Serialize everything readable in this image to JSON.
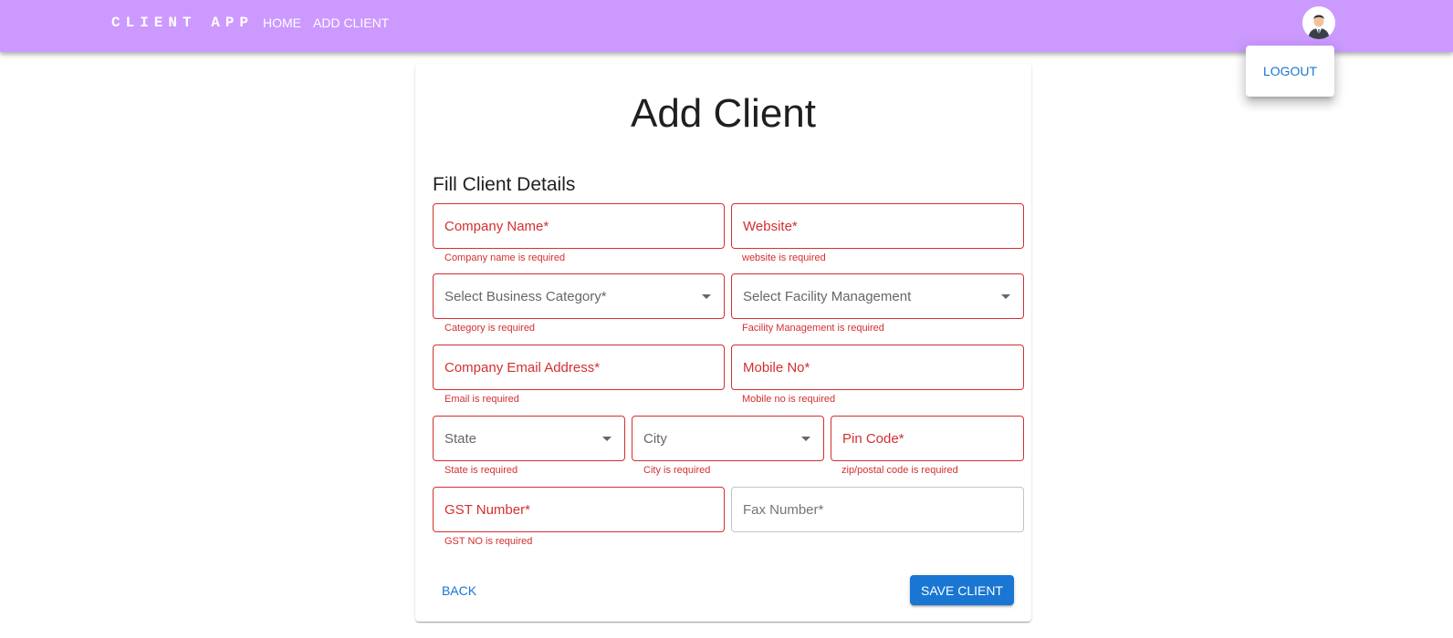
{
  "header": {
    "brand": "CLIENT APP",
    "nav": {
      "home": "HOME",
      "add_client": "ADD CLIENT"
    },
    "avatar_icon": "user-avatar-icon"
  },
  "user_menu": {
    "logout": "LOGOUT"
  },
  "form": {
    "title": "Add Client",
    "subtitle": "Fill Client Details",
    "fields": {
      "company_name": {
        "label": "Company Name*",
        "error": "Company name is required"
      },
      "website": {
        "label": "Website*",
        "error": "website is required"
      },
      "business_category": {
        "label": "Select Business Category*",
        "error": "Category is required"
      },
      "facility_management": {
        "label": "Select Facility Management",
        "error": "Facility Management is required"
      },
      "company_email": {
        "label": "Company Email Address*",
        "error": "Email is required"
      },
      "mobile_no": {
        "label": "Mobile No*",
        "error": "Mobile no is required"
      },
      "state": {
        "label": "State",
        "error": "State is required"
      },
      "city": {
        "label": "City",
        "error": "City is required"
      },
      "pin_code": {
        "label": "Pin Code*",
        "error": "zip/postal code is required"
      },
      "gst_number": {
        "label": "GST Number*",
        "error": "GST NO is required"
      },
      "fax_number": {
        "label": "Fax Number*"
      }
    },
    "actions": {
      "back": "BACK",
      "save": "SAVE CLIENT"
    }
  },
  "colors": {
    "appbar": "#cc99ff",
    "primary": "#1976d2",
    "error": "#d32f2f"
  }
}
